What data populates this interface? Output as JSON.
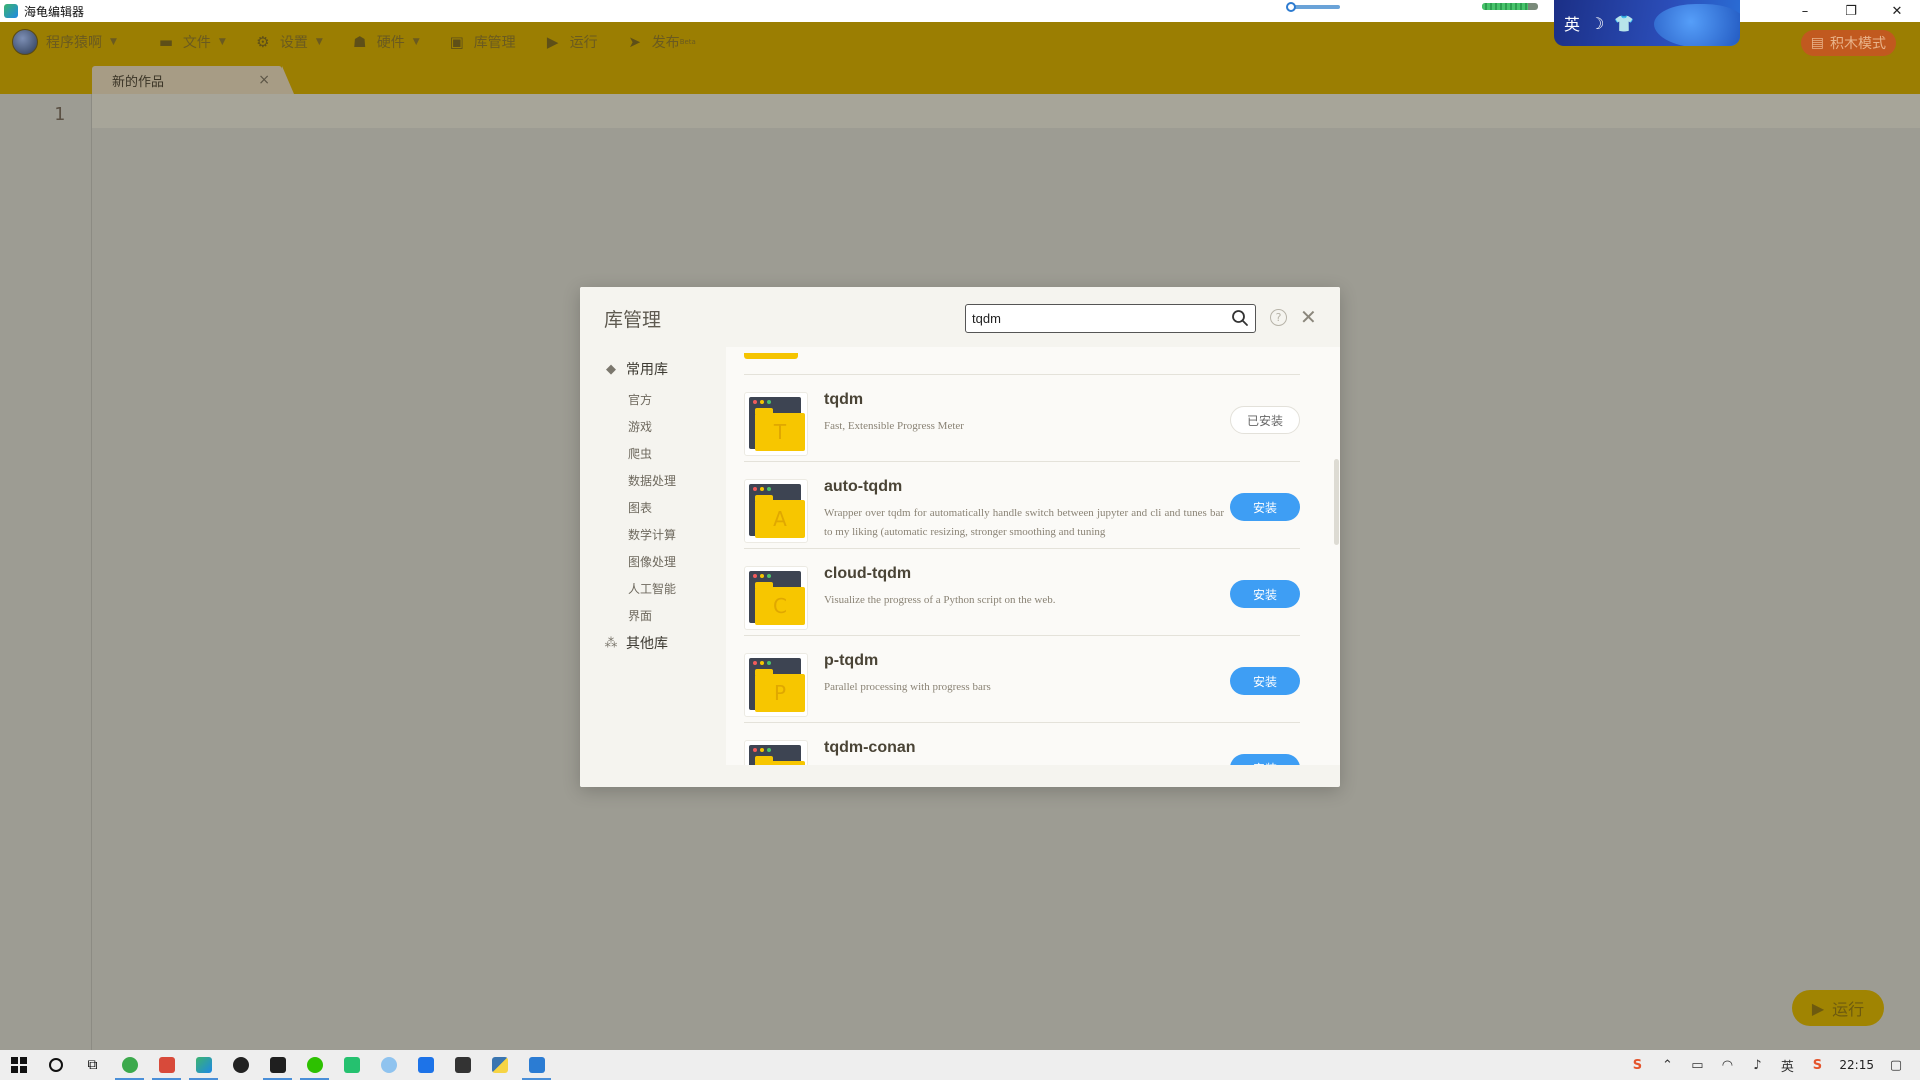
{
  "window": {
    "title": "海龟编辑器",
    "minimize": "–",
    "restore": "❐",
    "close": "✕"
  },
  "ime": {
    "lang": "英",
    "icons": [
      "moon-icon",
      "shirt-icon"
    ]
  },
  "menu": {
    "user": "程序猿啊",
    "file": "文件",
    "settings": "设置",
    "hardware": "硬件",
    "library": "库管理",
    "run": "运行",
    "publish": "发布",
    "publish_badge": "Beta",
    "block_mode": "积木模式"
  },
  "tab": {
    "label": "新的作品",
    "close": "×"
  },
  "editor": {
    "line_numbers": [
      "1"
    ]
  },
  "run_button": "运行",
  "dialog": {
    "title": "库管理",
    "search_value": "tqdm",
    "help": "?",
    "close": "✕",
    "sidebar": {
      "common": "常用库",
      "subs": [
        "官方",
        "游戏",
        "爬虫",
        "数据处理",
        "图表",
        "数学计算",
        "图像处理",
        "人工智能",
        "界面"
      ],
      "other": "其他库"
    },
    "packages": [
      {
        "letter": "T",
        "name": "tqdm",
        "desc": "Fast, Extensible Progress Meter",
        "button": "已安装",
        "state": "installed"
      },
      {
        "letter": "A",
        "name": "auto-tqdm",
        "desc": "Wrapper over tqdm for automatically handle switch between jupyter and cli and tunes bar to my liking (automatic resizing, stronger smoothing and tuning",
        "button": "安装",
        "state": "install"
      },
      {
        "letter": "C",
        "name": "cloud-tqdm",
        "desc": "Visualize the progress of a Python script on the web.",
        "button": "安装",
        "state": "install"
      },
      {
        "letter": "P",
        "name": "p-tqdm",
        "desc": "Parallel processing with progress bars",
        "button": "安装",
        "state": "install"
      },
      {
        "letter": "T",
        "name": "tqdm-conan",
        "desc": "",
        "button": "安装",
        "state": "install"
      }
    ]
  },
  "taskbar": {
    "clock": "22:15",
    "ime_label": "英"
  },
  "colors": {
    "menubar": "#9b7e02",
    "install_blue": "#3e9ef4",
    "folder_yellow": "#f7c600"
  }
}
